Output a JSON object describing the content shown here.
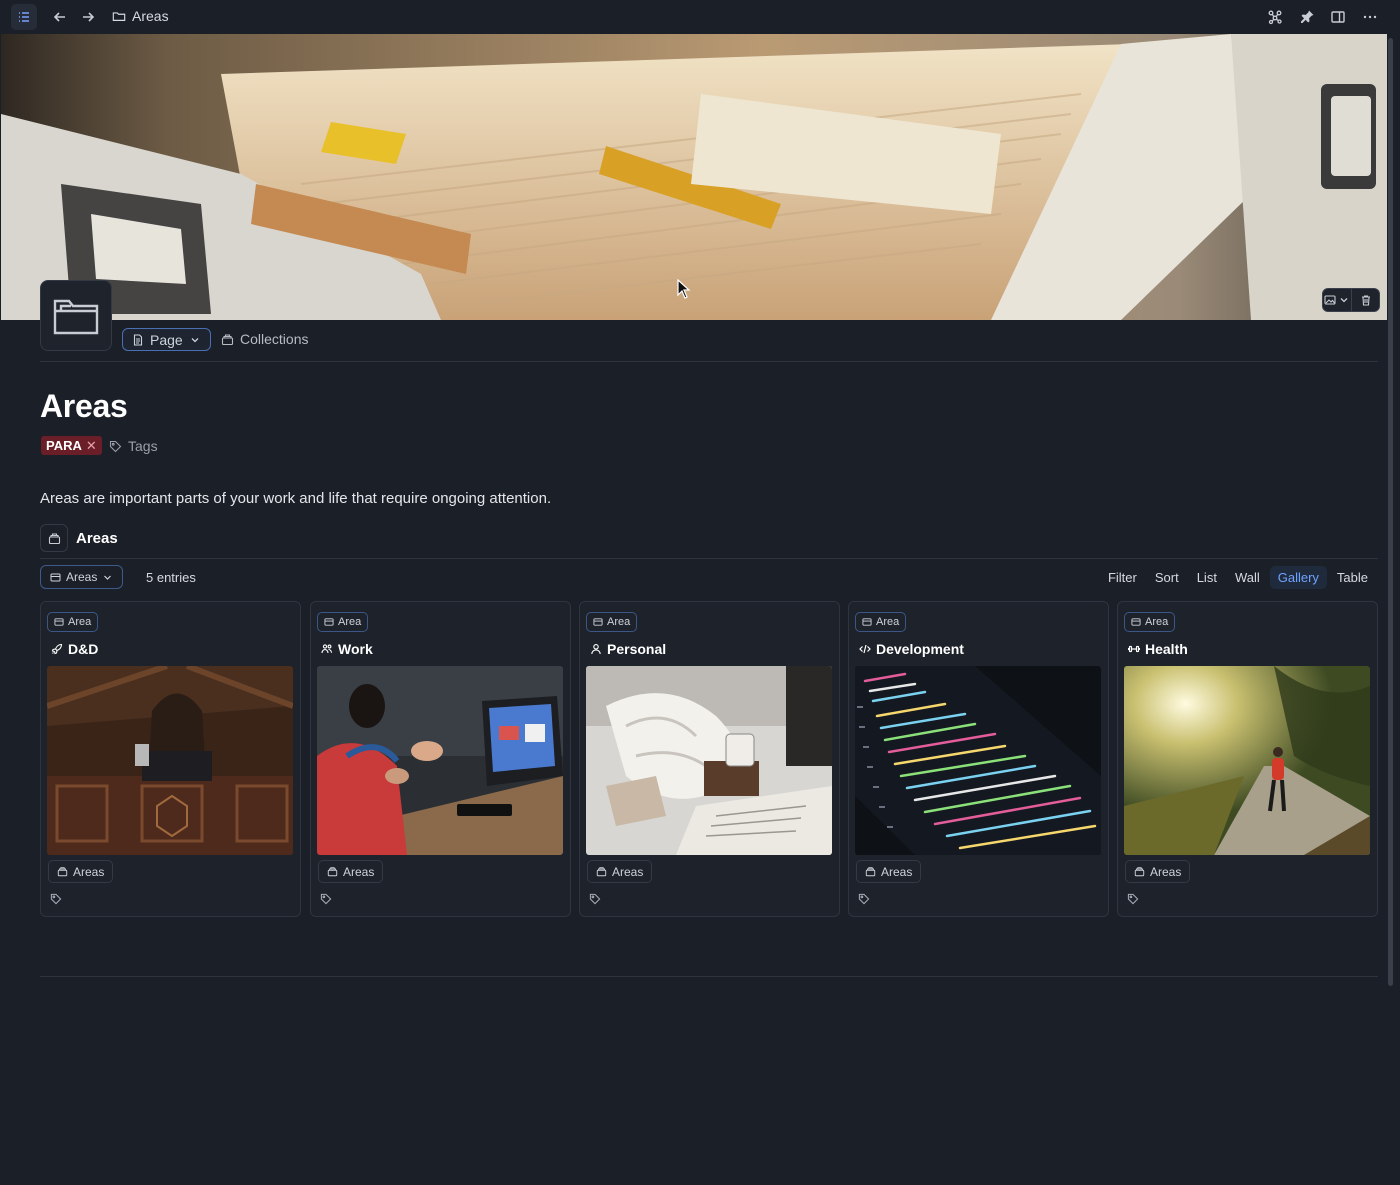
{
  "topbar": {
    "breadcrumb": "Areas",
    "icons": [
      "sidebar-toggle-icon",
      "back-arrow-icon",
      "forward-arrow-icon",
      "graph-icon",
      "pin-icon",
      "split-pane-icon",
      "more-icon"
    ]
  },
  "header": {
    "type_label": "Page",
    "collections_label": "Collections",
    "title": "Areas",
    "tag": "PARA",
    "tags_label": "Tags",
    "description": "Areas are important parts of your work and life that require ongoing attention."
  },
  "collection": {
    "title": "Areas",
    "view_label": "Areas",
    "entries": "5 entries",
    "tools": {
      "filter": "Filter",
      "sort": "Sort",
      "list": "List",
      "wall": "Wall",
      "gallery": "Gallery",
      "table": "Table"
    },
    "active_view": "Gallery"
  },
  "cards": [
    {
      "badge": "Area",
      "name": "D&D",
      "icon": "rocket-icon",
      "collection": "Areas"
    },
    {
      "badge": "Area",
      "name": "Work",
      "icon": "people-icon",
      "collection": "Areas"
    },
    {
      "badge": "Area",
      "name": "Personal",
      "icon": "person-icon",
      "collection": "Areas"
    },
    {
      "badge": "Area",
      "name": "Development",
      "icon": "code-icon",
      "collection": "Areas"
    },
    {
      "badge": "Area",
      "name": "Health",
      "icon": "dumbbell-icon",
      "collection": "Areas"
    }
  ],
  "colors": {
    "background": "#1b1f27",
    "accent": "#6ea3ff",
    "tag": "#6a1f28"
  }
}
